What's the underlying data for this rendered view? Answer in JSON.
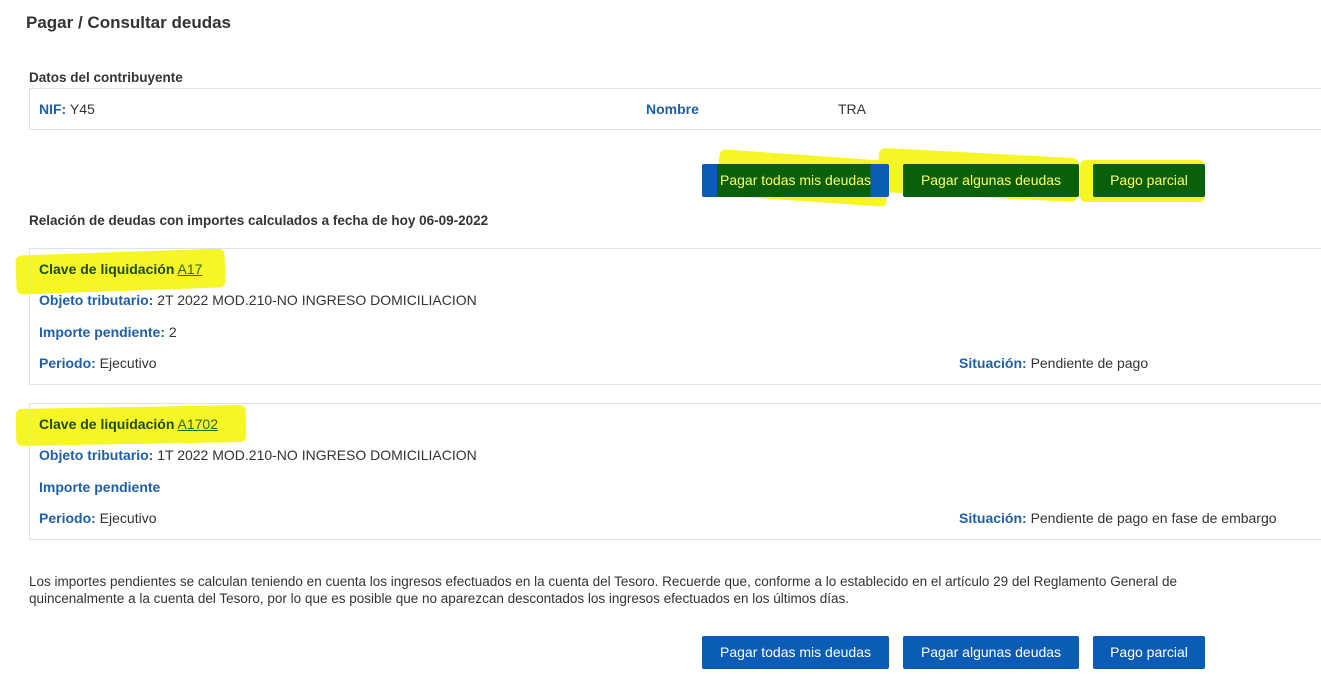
{
  "page": {
    "title": "Pagar / Consultar deudas"
  },
  "taxpayer": {
    "section_label": "Datos del contribuyente",
    "nif_label": "NIF:",
    "nif_value": "Y45",
    "name_label": "Nombre",
    "name_value": "TRA"
  },
  "actions": {
    "pay_all": "Pagar todas mis deudas",
    "pay_some": "Pagar algunas deudas",
    "partial": "Pago parcial"
  },
  "debts_header": "Relación de deudas con importes calculados a fecha de hoy 06-09-2022",
  "debts": [
    {
      "clave_label": "Clave de liquidación",
      "clave_value": "A17",
      "objeto_label": "Objeto tributario:",
      "objeto_value": "2T 2022 MOD.210-NO INGRESO DOMICILIACION",
      "importe_label": "Importe pendiente:",
      "importe_value": "2",
      "periodo_label": "Periodo:",
      "periodo_value": "Ejecutivo",
      "situacion_label": "Situación:",
      "situacion_value": "Pendiente de pago"
    },
    {
      "clave_label": "Clave de liquidación",
      "clave_value": "A1702",
      "objeto_label": "Objeto tributario:",
      "objeto_value": "1T 2022 MOD.210-NO INGRESO DOMICILIACION",
      "importe_label": "Importe pendiente",
      "importe_value": "",
      "periodo_label": "Periodo:",
      "periodo_value": "Ejecutivo",
      "situacion_label": "Situación:",
      "situacion_value": "Pendiente de pago en fase de embargo"
    }
  ],
  "note": {
    "line1": "Los importes pendientes se calculan teniendo en cuenta los ingresos efectuados en la cuenta del Tesoro. Recuerde que, conforme a lo establecido en el artículo 29 del Reglamento General de",
    "line2": "quincenalmente a la cuenta del Tesoro, por lo que es posible que no aparezcan descontados los ingresos efectuados en los últimos días."
  },
  "colors": {
    "primary_button": "#0b5cb5",
    "label_blue": "#1f5fa6",
    "highlight": "#f5f500"
  }
}
